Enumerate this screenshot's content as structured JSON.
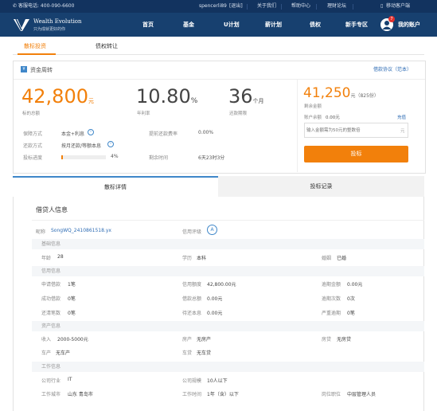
{
  "topbar": {
    "hotline": "客服电话: 400-090-6600",
    "user": "spencerli89",
    "logout": "[退出]",
    "about": "关于我们",
    "help": "帮助中心",
    "forum": "理财论坛",
    "mobile": "移动客户端"
  },
  "brand": {
    "name": "Wealth Evolution",
    "slogan": "只为成就更好的你"
  },
  "nav": {
    "items": [
      "首页",
      "基金",
      "U计划",
      "薪计划",
      "债权",
      "新手专区"
    ],
    "account": "我的账户",
    "badge": "7"
  },
  "subtabs": {
    "bidding": "散标投资",
    "transfer": "债权转让"
  },
  "loan": {
    "title": "资金周转",
    "agreement": "借款协议（范本）",
    "amount": "42,800",
    "amount_unit": "元",
    "amount_label": "标的总额",
    "rate": "10.80",
    "rate_unit": "%",
    "rate_label": "年利率",
    "term": "36",
    "term_unit": "个月",
    "term_label": "还款期限",
    "guarantee_label": "保障方式",
    "guarantee_value": "本金+利息",
    "repay_label": "还款方式",
    "repay_value": "按月还款/等额本息",
    "progress_label": "投标进度",
    "progress_value": "4%",
    "progress_fraction": 0.04,
    "prepay_label": "提前还款费率",
    "prepay_value": "0.00%",
    "remaining_label": "剩余时间",
    "remaining_value": "6天23时3分"
  },
  "invest": {
    "remaining_amount": "41,250",
    "remaining_unit": "元（825份）",
    "remaining_label": "剩余金额",
    "balance_label": "账户余额",
    "balance_value": "0.00元",
    "recharge": "充值",
    "placeholder": "输入金额需为50元的整数倍",
    "input_unit": "元",
    "button": "投标"
  },
  "detail_tabs": {
    "detail": "散标详情",
    "records": "投标记录"
  },
  "borrower": {
    "title": "借贷人信息",
    "nickname_label": "昵称",
    "nickname_value": "SongWQ_2410861518.yx",
    "credit_label": "信用评级",
    "credit_value": "A",
    "basic_header": "基础信息",
    "age_label": "年龄",
    "age_value": "28",
    "edu_label": "学历",
    "edu_value": "本科",
    "marriage_label": "婚姻",
    "marriage_value": "已婚",
    "credit_header": "信用信息",
    "apply_label": "申请借款",
    "apply_value": "1笔",
    "limit_label": "信用额度",
    "limit_value": "42,800.00元",
    "overdue_amount_label": "逾期金额",
    "overdue_amount_value": "0.00元",
    "success_label": "成功借款",
    "success_value": "0笔",
    "total_loan_label": "借款总额",
    "total_loan_value": "0.00元",
    "overdue_count_label": "逾期次数",
    "overdue_count_value": "0次",
    "repaid_label": "还清笔数",
    "repaid_value": "0笔",
    "pending_label": "待还本息",
    "pending_value": "0.00元",
    "severe_label": "严重逾期",
    "severe_value": "0笔",
    "asset_header": "资产信息",
    "income_label": "收入",
    "income_value": "2000-5000元",
    "house_label": "房产",
    "house_value": "无房产",
    "mortgage_label": "房贷",
    "mortgage_value": "无房贷",
    "car_label": "车产",
    "car_value": "无车产",
    "carloan_label": "车贷",
    "carloan_value": "无车贷",
    "work_header": "工作信息",
    "industry_label": "公司行业",
    "industry_value": "IT",
    "scale_label": "公司规模",
    "scale_value": "10人以下",
    "city_label": "工作城市",
    "city_value": "山东 青岛市",
    "years_label": "工作时间",
    "years_value": "1年（含）以下",
    "position_label": "岗位职位",
    "position_value": "中层管理人员"
  },
  "colors": {
    "header_dark": "#12335f",
    "header": "#17406f",
    "accent": "#f2800b",
    "link": "#2f6db5"
  }
}
